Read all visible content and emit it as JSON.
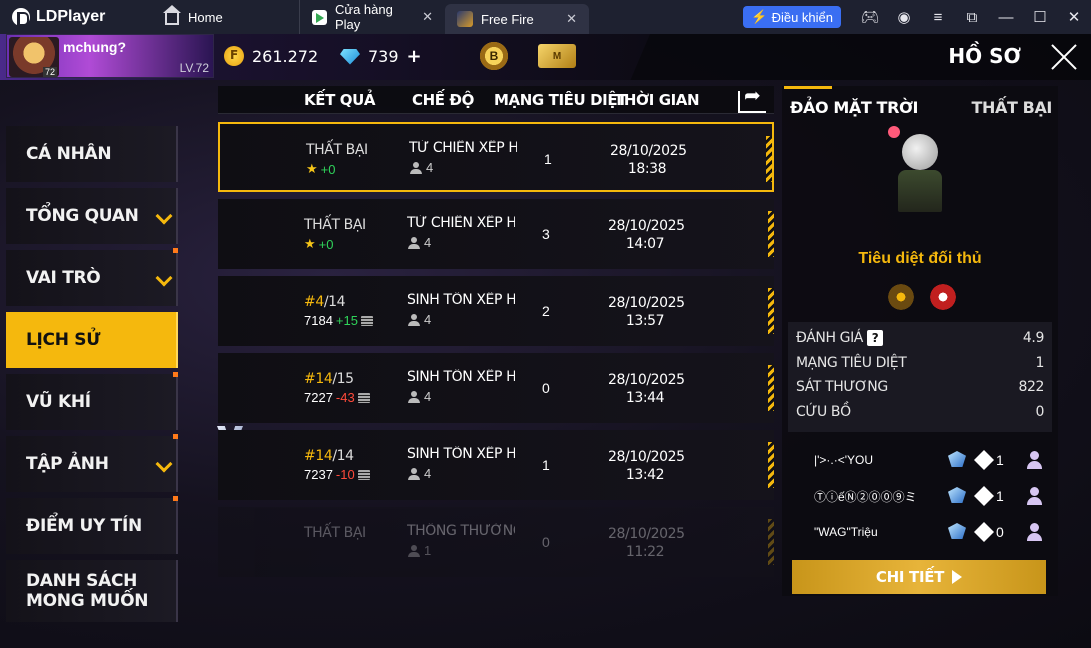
{
  "titlebar": {
    "brand": "LDPlayer",
    "tabs": [
      {
        "label": "Home"
      },
      {
        "label": "Cửa hàng Play"
      },
      {
        "label": "Free Fire"
      }
    ],
    "control_button": "Điều khiển"
  },
  "header": {
    "player_name": "mchung?",
    "avatar_level": "72",
    "player_level": "LV.72",
    "gold": "261.272",
    "diamonds": "739",
    "rank_badge": "B",
    "card_badge": "M",
    "title": "HỒ SƠ"
  },
  "sidebar": {
    "items": [
      {
        "label": "CÁ NHÂN"
      },
      {
        "label": "TỔNG QUAN"
      },
      {
        "label": "VAI TRÒ"
      },
      {
        "label": "LỊCH SỬ"
      },
      {
        "label": "VŨ KHÍ"
      },
      {
        "label": "TẬP ẢNH"
      },
      {
        "label": "ĐIỂM UY TÍN"
      },
      {
        "label": "DANH SÁCH\nMONG MUỐN"
      }
    ]
  },
  "table": {
    "headers": {
      "result": "KẾT QUẢ",
      "mode": "CHẾ ĐỘ",
      "kills": "MẠNG TIÊU DIỆT",
      "time": "THỜI GIAN"
    },
    "rows": [
      {
        "result": "THẤT BẠI",
        "sub_a": "★",
        "sub_b": "+0",
        "mode": "TỬ CHIẾN XẾP HẠ",
        "players": "4",
        "kills": "1",
        "date": "28/10/2025",
        "time": "18:38"
      },
      {
        "result": "THẤT BẠI",
        "sub_a": "★",
        "sub_b": "+0",
        "mode": "TỬ CHIẾN XẾP HẠ",
        "players": "4",
        "kills": "3",
        "date": "28/10/2025",
        "time": "14:07"
      },
      {
        "rank": "#4",
        "total": "/14",
        "sub_a": "7184",
        "sub_b": "+15",
        "mode": "SINH TỒN XẾP HẠ",
        "players": "4",
        "kills": "2",
        "date": "28/10/2025",
        "time": "13:57"
      },
      {
        "rank": "#14",
        "total": "/15",
        "sub_a": "7227",
        "sub_b": "-43",
        "mode": "SINH TỒN XẾP HẠ",
        "players": "4",
        "kills": "0",
        "date": "28/10/2025",
        "time": "13:44"
      },
      {
        "rank": "#14",
        "total": "/14",
        "sub_a": "7237",
        "sub_b": "-10",
        "mode": "SINH TỒN XẾP HẠ",
        "players": "4",
        "kills": "1",
        "date": "28/10/2025",
        "time": "13:42"
      },
      {
        "result": "THẤT BẠI",
        "mode": "THÔNG THƯỜNG-I",
        "players": "1",
        "kills": "0",
        "date": "28/10/2025",
        "time": "11:22"
      }
    ]
  },
  "detail": {
    "map": "ĐẢO MẶT TRỜI",
    "result": "THẤT BẠI",
    "action": "Tiêu diệt đối thủ",
    "stats": [
      {
        "label": "ĐÁNH GIÁ",
        "value": "4.9"
      },
      {
        "label": "MẠNG TIÊU DIỆT",
        "value": "1"
      },
      {
        "label": "SÁT THƯƠNG",
        "value": "822"
      },
      {
        "label": "CỨU BỒ",
        "value": "0"
      }
    ],
    "help": "?",
    "teammates": [
      {
        "name": "|'>·.·<'YOU",
        "kills": "1"
      },
      {
        "name": "ⓉⓘếⓃ②⓪⓪⑨ミ",
        "kills": "1"
      },
      {
        "name": "\"WAG\"Triệu",
        "kills": "0"
      }
    ],
    "button": "CHI TIẾT"
  },
  "colors": {
    "accent": "#f5b80d",
    "positive": "#2fd35a",
    "negative": "#ff4a3a",
    "titlebar": "#1e2130",
    "control_button": "#3a6ef2"
  }
}
